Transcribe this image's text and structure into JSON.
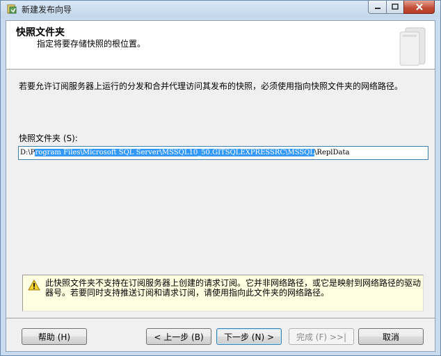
{
  "window": {
    "title": "新建发布向导"
  },
  "header": {
    "title": "快照文件夹",
    "subtitle": "指定将要存储快照的根位置。"
  },
  "main": {
    "description": "若要允许订阅服务器上运行的分发和合并代理访问其发布的快照，必须使用指向快照文件夹的网络路径。",
    "folder_label": "快照文件夹 (S):",
    "folder_path_prefix": "D:\\P",
    "folder_path_selected": "rogram Files\\Microsoft SQL Server\\MSSQL10_50.GITSQLEXPRESSRC\\MSSQL",
    "folder_path_suffix": "\\ReplData",
    "warning": "此快照文件夹不支持在订阅服务器上创建的请求订阅。它并非网络路径，或它是映射到网络路径的驱动器号。若要同时支持推送订阅和请求订阅，请使用指向此文件夹的网络路径。"
  },
  "footer": {
    "help_label": "帮助 (H)",
    "back_label": "< 上一步 (B)",
    "next_label": "下一步 (N) >",
    "finish_label": "完成 (F) >>|",
    "cancel_label": "取消"
  },
  "colors": {
    "selection": "#3399ff",
    "warning_bg": "#ffffe1",
    "close_button": "#c4503a"
  },
  "icons": [
    "wizard-app-icon",
    "minimize-icon",
    "maximize-icon",
    "close-icon",
    "header-art-icon",
    "warning-icon"
  ]
}
